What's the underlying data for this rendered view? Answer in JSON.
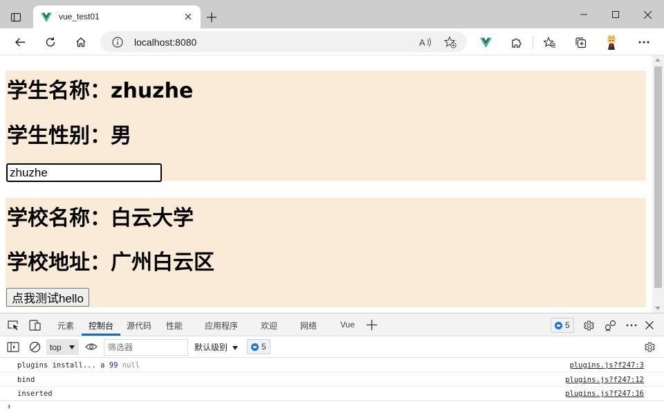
{
  "browser": {
    "tab": {
      "title": "vue_test01",
      "favicon": "vue-logo-icon"
    },
    "address": {
      "url": "localhost:8080"
    },
    "colors": {
      "tabstrip": "#cdcdcd",
      "vue_green": "#41b883",
      "vue_dark": "#35495e"
    }
  },
  "page": {
    "student": {
      "name_label": "学生名称：zhuzhe",
      "sex_label": "学生性别：男",
      "input_value": "zhuzhe"
    },
    "school": {
      "name_label": "学校名称：白云大学",
      "address_label": "学校地址：广州白云区",
      "button_label": "点我测试hello"
    },
    "box_color": "#faebd7"
  },
  "devtools": {
    "tabs": [
      "元素",
      "控制台",
      "源代码",
      "性能",
      "应用程序",
      "欢迎",
      "网络",
      "Vue"
    ],
    "active_tab": "控制台",
    "issues_count": "5",
    "console_bar": {
      "context": "top",
      "filter_placeholder": "筛选器",
      "level": "默认级别",
      "issues_count": "5"
    },
    "logs": [
      {
        "text": "plugins install... a ",
        "num": "99",
        "tail": " null",
        "source": "plugins.js?f247:3"
      },
      {
        "text": "bind",
        "num": "",
        "tail": "",
        "source": "plugins.js?f247:12"
      },
      {
        "text": "inserted",
        "num": "",
        "tail": "",
        "source": "plugins.js?f247:16"
      }
    ],
    "prompt": "›"
  }
}
